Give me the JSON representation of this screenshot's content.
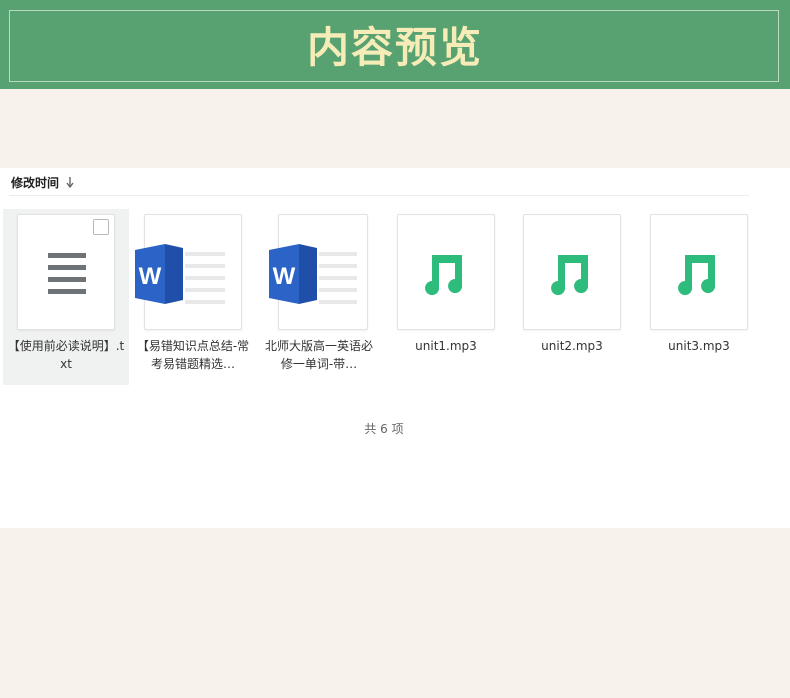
{
  "banner": {
    "title": "内容预览"
  },
  "toolbar": {
    "sort_label": "修改时间",
    "sort_icon": "arrow-down-icon"
  },
  "files": [
    {
      "name": "【使用前必读说明】.txt",
      "type": "txt",
      "icon": "text-file-icon",
      "selected": true
    },
    {
      "name": "【易错知识点总结-常考易错题精选…",
      "type": "docx",
      "icon": "word-file-icon"
    },
    {
      "name": "北师大版高一英语必修一单词-带…",
      "type": "docx",
      "icon": "word-file-icon"
    },
    {
      "name": "unit1.mp3",
      "type": "mp3",
      "icon": "music-file-icon"
    },
    {
      "name": "unit2.mp3",
      "type": "mp3",
      "icon": "music-file-icon"
    },
    {
      "name": "unit3.mp3",
      "type": "mp3",
      "icon": "music-file-icon"
    }
  ],
  "footer": {
    "count_text": "共 6 项"
  },
  "colors": {
    "banner_bg": "#58a170",
    "banner_text": "#f6ecb8",
    "word_blue": "#2b63c6",
    "music_green": "#2ebc7d"
  }
}
